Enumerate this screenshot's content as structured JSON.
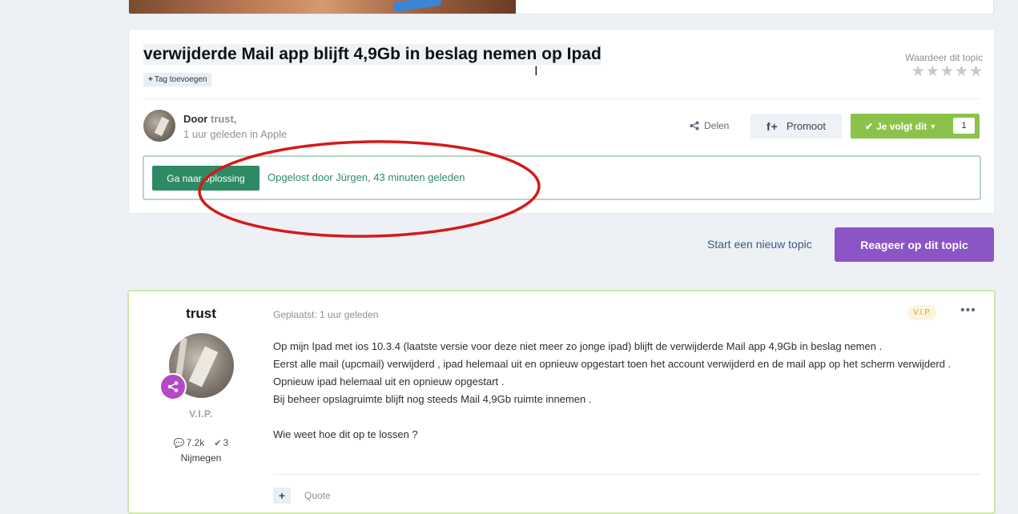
{
  "topic": {
    "title": "verwijderde Mail app blijft 4,9Gb in beslag nemen op Ipad",
    "tag_add_label": "Tag toevoegen",
    "rate_label": "Waardeer dit topic",
    "rating": {
      "value": 0,
      "max": 5
    },
    "author_prefix": "Door",
    "author_name": "trust",
    "author_suffix": ",",
    "posted_info": "1 uur geleden in Apple",
    "share_label": "Delen",
    "promote_label": "Promoot",
    "follow_label": "Je volgt dit",
    "follow_count": "1",
    "solution_button": "Ga naar oplossing",
    "solution_text": "Opgelost door Jürgen, 43 minuten geleden"
  },
  "actions": {
    "new_topic": "Start een nieuw topic",
    "reply": "Reageer op dit topic"
  },
  "post": {
    "author": "trust",
    "rank": "V.I.P.",
    "posts_count": "7.2k",
    "solutions_count": "3",
    "location": "Nijmegen",
    "posted": "Geplaatst: 1 uur geleden",
    "badge": "V.I.P.",
    "more": "•••",
    "body": [
      "Op mijn Ipad  met ios 10.3.4 (laatste versie voor deze niet meer zo jonge ipad) blijft de verwijderde Mail app  4,9Gb in beslag nemen .",
      "Eerst alle mail (upcmail) verwijderd , ipad helemaal uit en opnieuw opgestart toen het account verwijderd en de mail app op het scherm verwijderd .",
      "Opnieuw ipad helemaal uit en opnieuw opgestart .",
      "Bij beheer opslagruimte blijft nog steeds Mail 4,9Gb ruimte innemen .",
      "Wie weet hoe dit op te lossen ?"
    ],
    "quote_label": "Quote"
  },
  "colors": {
    "accent_green": "#8bc34a",
    "solution_green": "#2e8a64",
    "reply_purple": "#8b55c5",
    "annotation_red": "#d41a1a"
  },
  "icons": {
    "share": "share-icon",
    "facebook": "facebook-icon",
    "follow": "check-icon",
    "posts": "comment-icon",
    "solutions": "check-circle-icon",
    "rank": "share-nodes-icon"
  }
}
